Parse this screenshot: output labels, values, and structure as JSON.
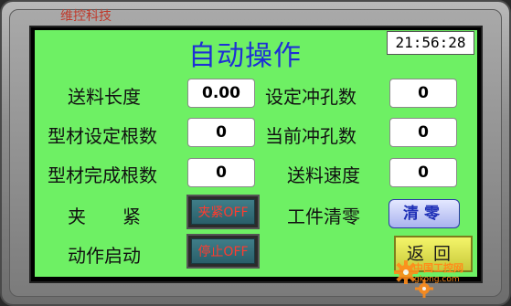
{
  "brand": "维控科技",
  "title": "自动操作",
  "clock": "21:56:28",
  "rows": {
    "feed_length": {
      "label": "送料长度",
      "value": "0.00"
    },
    "set_punch_count": {
      "label": "设定冲孔数",
      "value": "0"
    },
    "profile_set_count": {
      "label": "型材设定根数",
      "value": "0"
    },
    "current_punch_count": {
      "label": "当前冲孔数",
      "value": "0"
    },
    "profile_done_count": {
      "label": "型材完成根数",
      "value": "0"
    },
    "feed_speed": {
      "label": "送料速度",
      "value": "0"
    }
  },
  "clamp": {
    "label": "夹　　紧",
    "button": "夹紧OFF"
  },
  "action_start": {
    "label": "动作启动",
    "button": "停止OFF"
  },
  "workpiece_clear": {
    "label": "工件清零",
    "button": "清零"
  },
  "back": {
    "button": "返回"
  },
  "watermark": {
    "text": "中国工控网",
    "url": "gkong.com"
  },
  "colors": {
    "panel": "#6ef064",
    "title": "#1e2fd6",
    "toggle_text": "#ff3b2f",
    "clear_button": "#a9b3ef",
    "back_button": "#f4f56a",
    "brand": "#c0392b"
  }
}
